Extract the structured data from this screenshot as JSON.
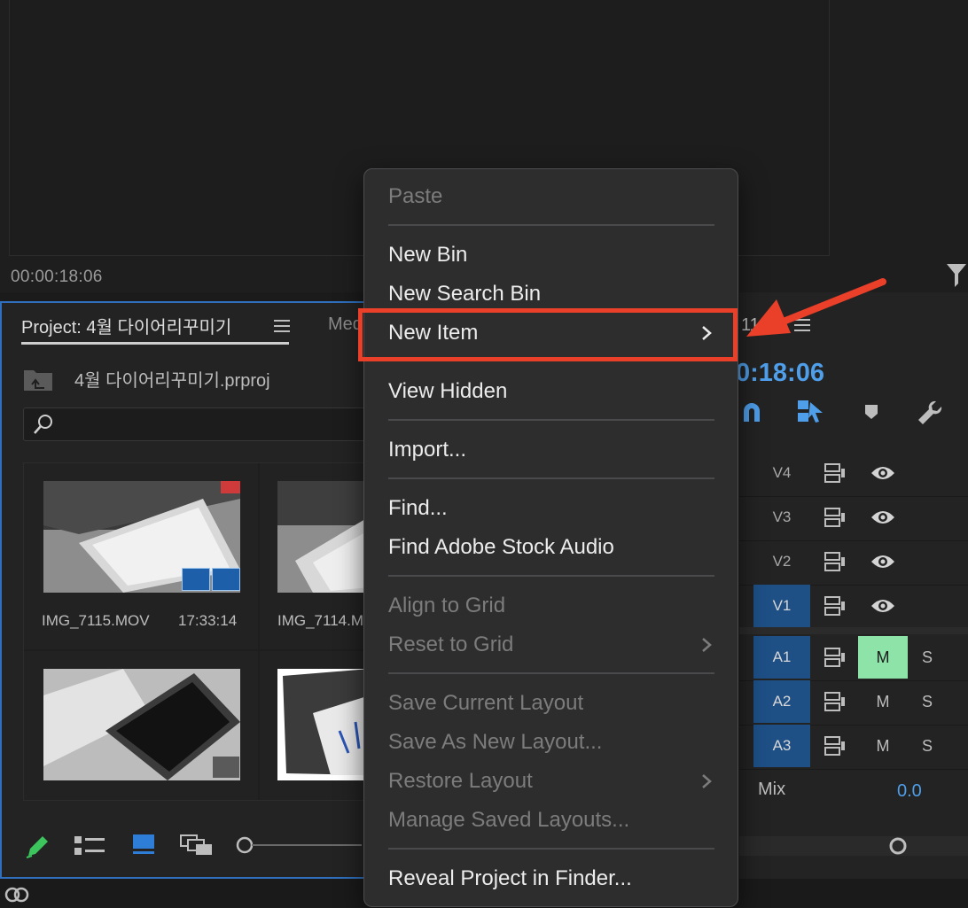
{
  "monitor": {
    "timecode": "00:00:18:06"
  },
  "project": {
    "tab_label": "Project: 4월 다이어리꾸미기",
    "other_tab_label": "Med",
    "file_name": "4월 다이어리꾸미기.prproj",
    "items": [
      {
        "name": "IMG_7115.MOV",
        "duration": "17:33:14"
      },
      {
        "name": "IMG_7114.M",
        "duration": ""
      },
      {
        "name": "",
        "duration": ""
      },
      {
        "name": "",
        "duration": ""
      }
    ]
  },
  "timeline": {
    "tab_fragment": "11",
    "timecode": "0:18:06",
    "video_tracks": [
      "V4",
      "V3",
      "V2",
      "V1"
    ],
    "audio_tracks": [
      "A1",
      "A2",
      "A3"
    ],
    "mute_label": "M",
    "solo_label": "S",
    "mix_label": "Mix",
    "mix_value": "0.0"
  },
  "context_menu": {
    "items": [
      {
        "label": "Paste",
        "enabled": false
      },
      {
        "label": "New Bin",
        "enabled": true
      },
      {
        "label": "New Search Bin",
        "enabled": true
      },
      {
        "label": "New Item",
        "enabled": true,
        "submenu": true,
        "highlighted": true
      },
      {
        "label": "View Hidden",
        "enabled": true
      },
      {
        "label": "Import...",
        "enabled": true
      },
      {
        "label": "Find...",
        "enabled": true
      },
      {
        "label": "Find Adobe Stock Audio",
        "enabled": true
      },
      {
        "label": "Align to Grid",
        "enabled": false
      },
      {
        "label": "Reset to Grid",
        "enabled": false,
        "submenu": true
      },
      {
        "label": "Save Current Layout",
        "enabled": false
      },
      {
        "label": "Save As New Layout...",
        "enabled": false
      },
      {
        "label": "Restore Layout",
        "enabled": false,
        "submenu": true
      },
      {
        "label": "Manage Saved Layouts...",
        "enabled": false
      },
      {
        "label": "Reveal Project in Finder...",
        "enabled": true
      }
    ]
  },
  "colors": {
    "accent_blue": "#4e9eea",
    "active_track": "#1e4f85",
    "mute_on": "#8de3a8",
    "annotation_red": "#ea3f29",
    "panel_focus_border": "#2f6fbd"
  },
  "icons": [
    "filter-icon",
    "hamburger-menu-icon",
    "folder-up-icon",
    "search-icon",
    "film-badge-icon",
    "audio-badge-icon",
    "pencil-icon",
    "list-view-icon",
    "icon-view-icon",
    "freeform-view-icon",
    "magnet-snap-icon",
    "linked-selection-icon",
    "marker-icon",
    "wrench-icon",
    "sync-lock-icon",
    "eye-icon",
    "chevron-right-icon",
    "creative-cloud-icon"
  ]
}
